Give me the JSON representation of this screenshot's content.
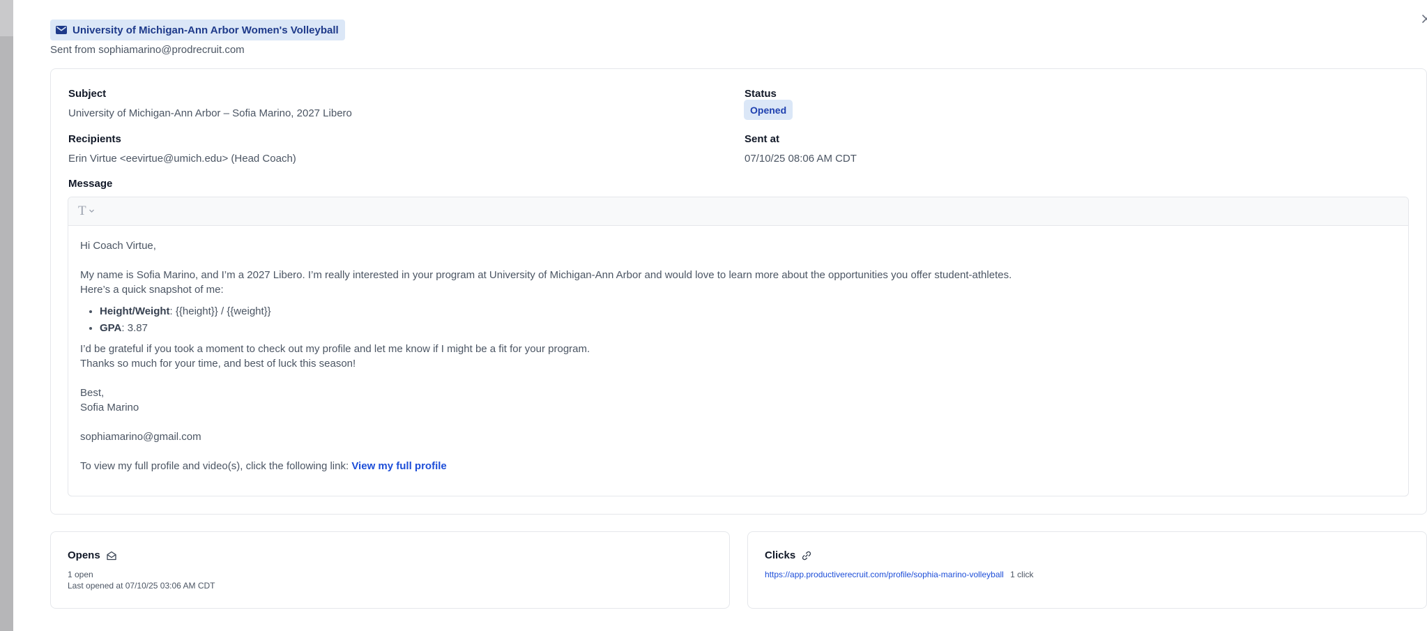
{
  "header": {
    "badge_title": "University of Michigan-Ann Arbor Women's Volleyball",
    "sent_from": "Sent from sophiamarino@prodrecruit.com",
    "icon": "mail-icon",
    "close_icon": "close-icon"
  },
  "details": {
    "subject_label": "Subject",
    "subject_value": "University of Michigan-Ann Arbor – Sofia Marino, 2027 Libero",
    "status_label": "Status",
    "status_value": "Opened",
    "recipients_label": "Recipients",
    "recipients_value": "Erin Virtue <eevirtue@umich.edu> (Head Coach)",
    "sent_at_label": "Sent at",
    "sent_at_value": "07/10/25 08:06 AM CDT",
    "message_label": "Message"
  },
  "message": {
    "toolbar_icon": "text-format-icon",
    "greeting": "Hi Coach Virtue,",
    "intro_line1": "My name is Sofia Marino, and I’m a 2027 Libero. I’m really interested in your program at University of Michigan-Ann Arbor and would love to learn more about the opportunities you offer student-athletes.",
    "intro_line2": "Here’s a quick snapshot of me:",
    "bullets": [
      {
        "label": "Height/Weight",
        "value": ": {{height}} / {{weight}}"
      },
      {
        "label": "GPA",
        "value": ": 3.87"
      }
    ],
    "closing_line1": "I’d be grateful if you took a moment to check out my profile and let me know if I might be a fit for your program.",
    "closing_line2": "Thanks so much for your time, and best of luck this season!",
    "signoff": "Best,",
    "signature_name": "Sofia Marino",
    "signature_email": "sophiamarino@gmail.com",
    "profile_prompt": "To view my full profile and video(s), click the following link: ",
    "profile_link_text": "View my full profile"
  },
  "opens": {
    "title": "Opens",
    "icon": "envelope-open-icon",
    "count_text": "1 open",
    "last_opened": "Last opened at 07/10/25 03:06 AM CDT"
  },
  "clicks": {
    "title": "Clicks",
    "icon": "link-icon",
    "url": "https://app.productiverecruit.com/profile/sophia-marino-volleyball",
    "count_text": "1 click"
  },
  "colors": {
    "accent": "#1d4ed8",
    "badge_bg": "#dbe7f7",
    "badge_text": "#1e3a8a",
    "border": "#e5e7eb"
  }
}
